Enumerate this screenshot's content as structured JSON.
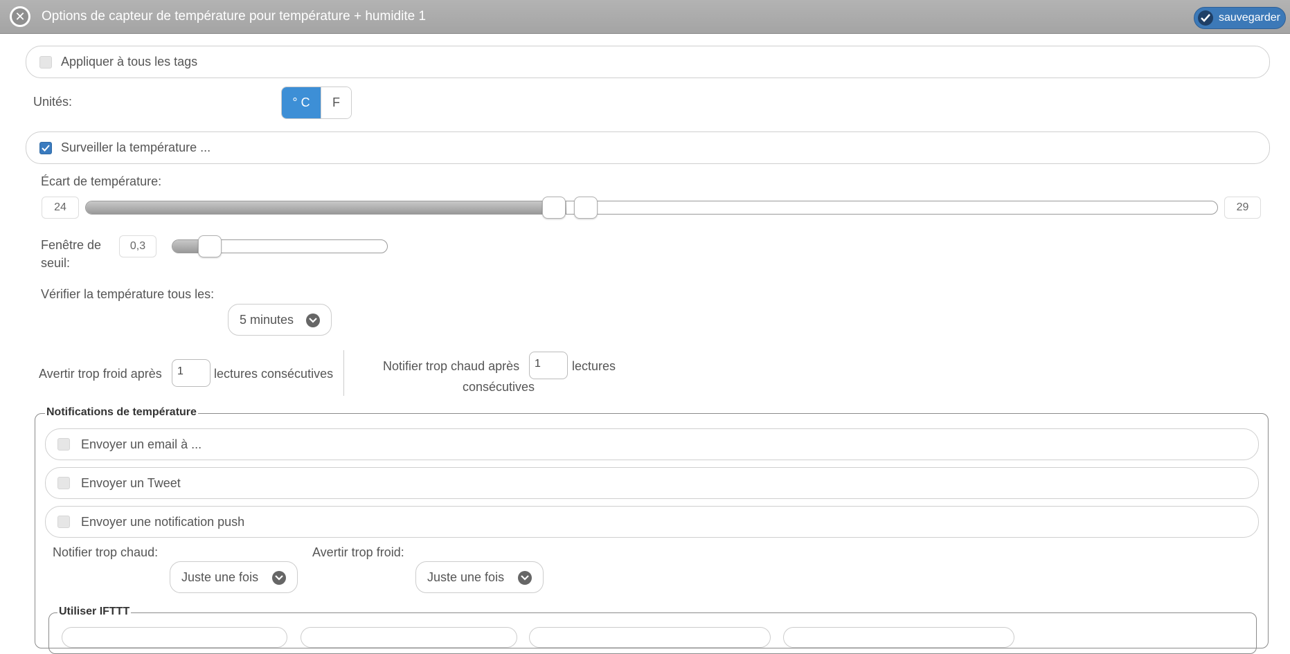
{
  "header": {
    "title": "Options de capteur de température pour température + humidite 1",
    "save_label": "sauvegarder"
  },
  "apply_all": {
    "label": "Appliquer à tous les tags",
    "checked": false
  },
  "units": {
    "label": "Unités:",
    "options": [
      "° C",
      "F"
    ],
    "selected": "° C"
  },
  "monitor": {
    "label": "Surveiller la température ...",
    "checked": true
  },
  "temp_range": {
    "label": "Écart de température:",
    "min": "24",
    "max": "29",
    "low_fraction": 0.414,
    "high_fraction": 0.442
  },
  "threshold": {
    "label_line1": "Fenêtre de",
    "label_line2": "seuil:",
    "value": "0,3",
    "fraction": 0.18
  },
  "check_interval": {
    "label": "Vérifier la température tous les:",
    "value": "5 minutes"
  },
  "cold_alert": {
    "prefix": "Avertir trop froid après",
    "count": "1",
    "suffix": "lectures consécutives"
  },
  "hot_alert": {
    "prefix": "Notifier trop chaud après",
    "count": "1",
    "suffix": "lectures",
    "suffix2": "consécutives"
  },
  "notifications": {
    "legend": "Notifications de température",
    "items": [
      {
        "label": "Envoyer un email à ...",
        "checked": false
      },
      {
        "label": "Envoyer un Tweet",
        "checked": false
      },
      {
        "label": "Envoyer une notification push",
        "checked": false
      }
    ],
    "hot_label": "Notifier trop chaud:",
    "hot_value": "Juste une fois",
    "cold_label": "Avertir trop froid:",
    "cold_value": "Juste une fois"
  },
  "ifttt": {
    "legend": "Utiliser IFTTT"
  },
  "colors": {
    "accent": "#3d8fd6",
    "header": "#a8a8a8",
    "save": "#3c79b8"
  }
}
